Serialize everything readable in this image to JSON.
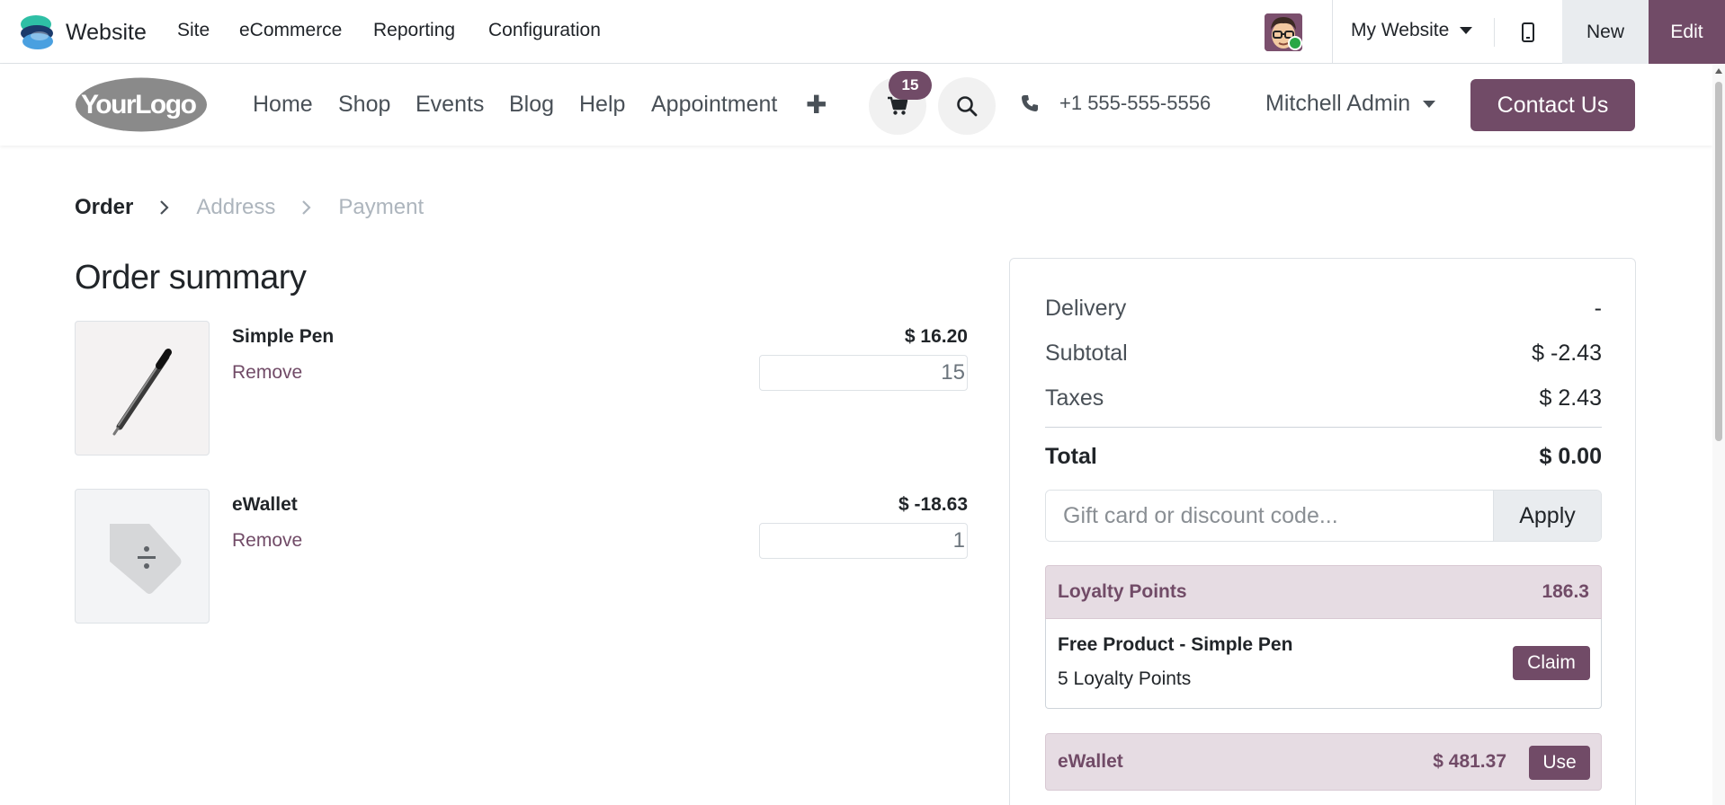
{
  "admin_bar": {
    "app_name": "Website",
    "menu": [
      "Site",
      "eCommerce",
      "Reporting",
      "Configuration"
    ],
    "website_selector": "My Website",
    "new_label": "New",
    "edit_label": "Edit"
  },
  "site_header": {
    "logo_text": "YourLogo",
    "nav": [
      "Home",
      "Shop",
      "Events",
      "Blog",
      "Help",
      "Appointment"
    ],
    "cart_count": "15",
    "phone": "+1 555-555-5556",
    "user_name": "Mitchell Admin",
    "contact_label": "Contact Us"
  },
  "steps": {
    "current": "Order",
    "items": [
      "Address",
      "Payment"
    ]
  },
  "order": {
    "title": "Order summary",
    "lines": [
      {
        "name": "Simple Pen",
        "remove_label": "Remove",
        "price": "$ 16.20",
        "qty": "15",
        "image": "pen-image"
      },
      {
        "name": "eWallet",
        "remove_label": "Remove",
        "price": "$ -18.63",
        "qty": "1",
        "image": "discount-tag-icon"
      }
    ]
  },
  "totals": {
    "delivery_label": "Delivery",
    "delivery": "-",
    "subtotal_label": "Subtotal",
    "subtotal": "$ -2.43",
    "taxes_label": "Taxes",
    "taxes": "$ 2.43",
    "total_label": "Total",
    "total": "$ 0.00"
  },
  "coupon": {
    "placeholder": "Gift card or discount code...",
    "apply_label": "Apply"
  },
  "loyalty": {
    "title": "Loyalty Points",
    "points": "186.3",
    "reward_name": "Free Product - Simple Pen",
    "reward_cost": "5 Loyalty Points",
    "claim_label": "Claim"
  },
  "ewallet": {
    "label": "eWallet",
    "amount": "$ 481.37",
    "use_label": "Use"
  },
  "colors": {
    "brand": "#714b67",
    "brand_light": "#e6dce3",
    "online_status": "#28a745"
  }
}
